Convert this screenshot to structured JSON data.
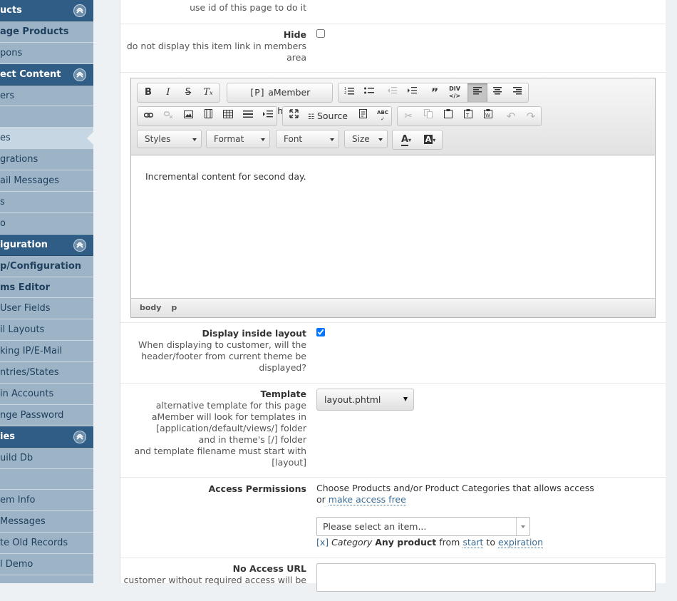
{
  "sidebar": {
    "items": [
      {
        "label": "ucts",
        "type": "header"
      },
      {
        "label": "age Products",
        "type": "bold"
      },
      {
        "label": "pons",
        "type": "normal"
      },
      {
        "label": "ect Content",
        "type": "header"
      },
      {
        "label": "ers",
        "type": "normal"
      },
      {
        "label": "",
        "type": "normal"
      },
      {
        "label": "es",
        "type": "active"
      },
      {
        "label": "grations",
        "type": "normal"
      },
      {
        "label": "ail Messages",
        "type": "normal"
      },
      {
        "label": "s",
        "type": "normal"
      },
      {
        "label": "o",
        "type": "normal"
      },
      {
        "label": "iguration",
        "type": "header"
      },
      {
        "label": "p/Configuration",
        "type": "bold"
      },
      {
        "label": "ms Editor",
        "type": "bold"
      },
      {
        "label": "User Fields",
        "type": "normal"
      },
      {
        "label": "il Layouts",
        "type": "normal"
      },
      {
        "label": "king IP/E-Mail",
        "type": "normal"
      },
      {
        "label": "ntries/States",
        "type": "normal"
      },
      {
        "label": "in Accounts",
        "type": "normal"
      },
      {
        "label": "nge Password",
        "type": "normal"
      },
      {
        "label": "ies",
        "type": "header"
      },
      {
        "label": "uild Db",
        "type": "normal"
      },
      {
        "label": "",
        "type": "normal"
      },
      {
        "label": "em Info",
        "type": "normal"
      },
      {
        "label": "Messages",
        "type": "normal"
      },
      {
        "label": "te Old Records",
        "type": "normal"
      },
      {
        "label": "l Demo",
        "type": "normal"
      },
      {
        "label": "",
        "type": "normal"
      }
    ]
  },
  "form": {
    "top_help": "use id of this page to do it",
    "hide": {
      "label": "Hide",
      "help": "do not display this item link in members area",
      "checked": false
    },
    "editor": {
      "placeholder_button": "aMember Placeholder",
      "source_button": "Source",
      "combos": {
        "styles": "Styles",
        "format": "Format",
        "font": "Font",
        "size": "Size"
      },
      "content": "Incremental content for second day.",
      "path": [
        "body",
        "p"
      ]
    },
    "display_layout": {
      "label": "Display inside layout",
      "help": "When displaying to customer, will the header/footer from current theme be displayed?",
      "checked": true
    },
    "template": {
      "label": "Template",
      "help": [
        "alternative template for this page",
        "aMember will look for templates in",
        "[application/default/views/] folder",
        "and in theme's [/] folder",
        "and template filename must start with",
        "[layout]"
      ],
      "value": "layout.phtml"
    },
    "access": {
      "label": "Access Permissions",
      "desc": "Choose Products and/or Product Categories that allows access",
      "or": "or",
      "free_link": "make access free",
      "select_placeholder": "Please select an item...",
      "entry": {
        "remove": "[x]",
        "kind": "Category",
        "name": "Any product",
        "from_word": "from",
        "from": "start",
        "to_word": "to",
        "to": "expiration"
      }
    },
    "no_access": {
      "label": "No Access URL",
      "help": "customer without required access will be"
    }
  }
}
